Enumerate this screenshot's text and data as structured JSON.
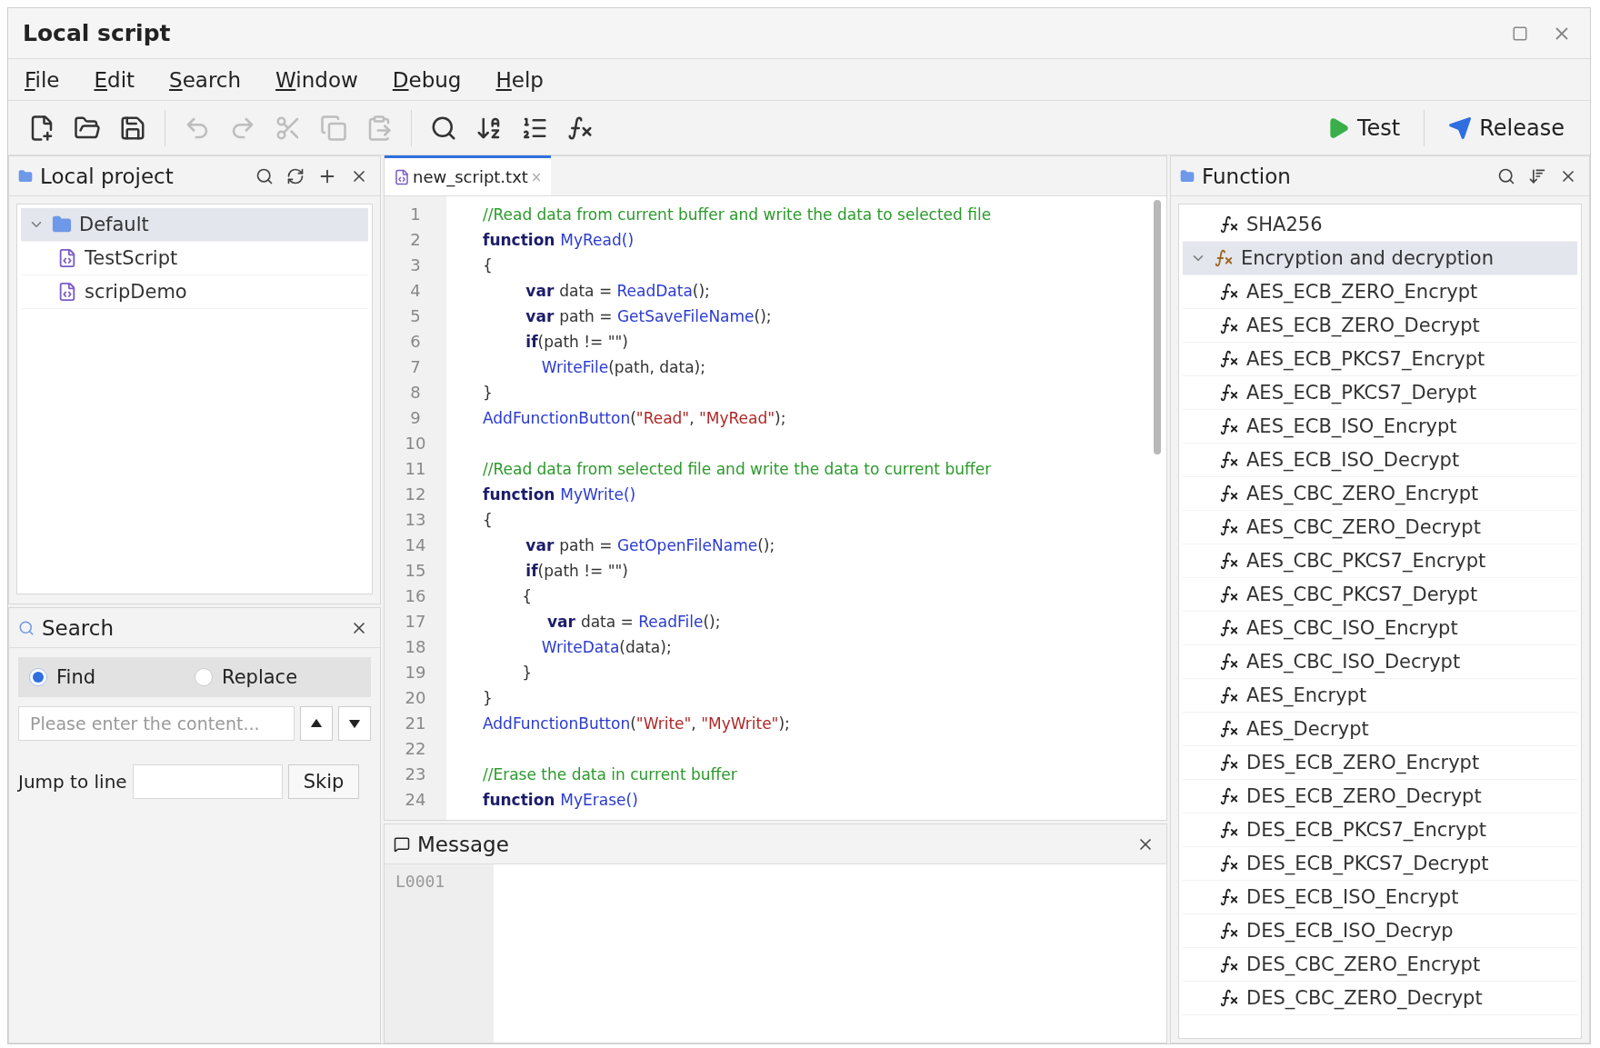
{
  "window": {
    "title": "Local script"
  },
  "menu": [
    {
      "label": "File"
    },
    {
      "label": "Edit"
    },
    {
      "label": "Search"
    },
    {
      "label": "Window"
    },
    {
      "label": "Debug"
    },
    {
      "label": "Help"
    }
  ],
  "toolbar": {
    "buttons": [
      {
        "disabled": false
      },
      {
        "disabled": false
      },
      {
        "disabled": false
      },
      {
        "disabled": true
      },
      {
        "disabled": true
      },
      {
        "disabled": true
      },
      {
        "disabled": true
      },
      {
        "disabled": true
      },
      {
        "disabled": false
      },
      {
        "disabled": false
      },
      {
        "disabled": false
      },
      {
        "disabled": false
      }
    ],
    "actions": [
      {
        "label": "Test"
      },
      {
        "label": "Release"
      }
    ]
  },
  "project_panel": {
    "title": "Local project",
    "tree": [
      {
        "label": "Default",
        "kind": "folder",
        "expanded": true,
        "selected": true,
        "children": [
          {
            "label": "TestScript",
            "kind": "script",
            "selected": false
          },
          {
            "label": "scripDemo",
            "kind": "script",
            "selected": false
          }
        ]
      }
    ]
  },
  "search_panel": {
    "title": "Search",
    "modes": [
      {
        "label": "Find",
        "selected": true
      },
      {
        "label": "Replace",
        "selected": false
      }
    ],
    "search_field": {
      "placeholder": "Please enter the content..."
    },
    "jump_label": "Jump to line",
    "jump_button": "Skip"
  },
  "editor": {
    "tabs": [
      {
        "label": "new_script.txt",
        "selected": true,
        "close": "×"
      }
    ],
    "lines": [
      {
        "number": "1",
        "tokens": [
          {
            "kind": "comment",
            "text": "//Read data from current buffer and write the data to selected file"
          }
        ]
      },
      {
        "number": "2",
        "tokens": [
          {
            "kind": "keyword",
            "text": "function "
          },
          {
            "kind": "func",
            "text": "MyRead()"
          }
        ]
      },
      {
        "number": "3",
        "tokens": [
          {
            "kind": "plain",
            "text": "{"
          }
        ]
      },
      {
        "number": "4",
        "tokens": [
          {
            "kind": "keyword",
            "text": "        var "
          },
          {
            "kind": "plain",
            "text": "data = "
          },
          {
            "kind": "func",
            "text": "ReadData"
          },
          {
            "kind": "plain",
            "text": "();"
          }
        ]
      },
      {
        "number": "5",
        "tokens": [
          {
            "kind": "keyword",
            "text": "        var "
          },
          {
            "kind": "plain",
            "text": "path = "
          },
          {
            "kind": "func",
            "text": "GetSaveFileName"
          },
          {
            "kind": "plain",
            "text": "();"
          }
        ]
      },
      {
        "number": "6",
        "tokens": [
          {
            "kind": "keyword",
            "text": "        if"
          },
          {
            "kind": "plain",
            "text": "(path != \"\")"
          }
        ]
      },
      {
        "number": "7",
        "tokens": [
          {
            "kind": "func",
            "text": "            WriteFile"
          },
          {
            "kind": "plain",
            "text": "(path, data);"
          }
        ]
      },
      {
        "number": "8",
        "tokens": [
          {
            "kind": "plain",
            "text": "}"
          }
        ]
      },
      {
        "number": "9",
        "tokens": [
          {
            "kind": "func",
            "text": "AddFunctionButton"
          },
          {
            "kind": "plain",
            "text": "("
          },
          {
            "kind": "string",
            "text": "\"Read\""
          },
          {
            "kind": "plain",
            "text": ", "
          },
          {
            "kind": "string",
            "text": "\"MyRead\""
          },
          {
            "kind": "plain",
            "text": ");"
          }
        ]
      },
      {
        "number": "10"
      },
      {
        "number": "11",
        "tokens": [
          {
            "kind": "comment",
            "text": "//Read data from selected file and write the data to current buffer"
          }
        ]
      },
      {
        "number": "12",
        "tokens": [
          {
            "kind": "keyword",
            "text": "function "
          },
          {
            "kind": "func",
            "text": "MyWrite()"
          }
        ]
      },
      {
        "number": "13",
        "tokens": [
          {
            "kind": "plain",
            "text": "{"
          }
        ]
      },
      {
        "number": "14",
        "tokens": [
          {
            "kind": "keyword",
            "text": "        var "
          },
          {
            "kind": "plain",
            "text": "path = "
          },
          {
            "kind": "func",
            "text": "GetOpenFileName"
          },
          {
            "kind": "plain",
            "text": "();"
          }
        ]
      },
      {
        "number": "15",
        "tokens": [
          {
            "kind": "keyword",
            "text": "        if"
          },
          {
            "kind": "plain",
            "text": "(path != \"\")"
          }
        ]
      },
      {
        "number": "16",
        "tokens": [
          {
            "kind": "plain",
            "text": "        {"
          }
        ]
      },
      {
        "number": "17",
        "tokens": [
          {
            "kind": "keyword",
            "text": "            var "
          },
          {
            "kind": "plain",
            "text": "data = "
          },
          {
            "kind": "func",
            "text": "ReadFile"
          },
          {
            "kind": "plain",
            "text": "();"
          }
        ]
      },
      {
        "number": "18",
        "tokens": [
          {
            "kind": "func",
            "text": "            WriteData"
          },
          {
            "kind": "plain",
            "text": "(data);"
          }
        ]
      },
      {
        "number": "19",
        "tokens": [
          {
            "kind": "plain",
            "text": "        }"
          }
        ]
      },
      {
        "number": "20",
        "tokens": [
          {
            "kind": "plain",
            "text": "}"
          }
        ]
      },
      {
        "number": "21",
        "tokens": [
          {
            "kind": "func",
            "text": "AddFunctionButton"
          },
          {
            "kind": "plain",
            "text": "("
          },
          {
            "kind": "string",
            "text": "\"Write\""
          },
          {
            "kind": "plain",
            "text": ", "
          },
          {
            "kind": "string",
            "text": "\"MyWrite\""
          },
          {
            "kind": "plain",
            "text": ");"
          }
        ]
      },
      {
        "number": "22"
      },
      {
        "number": "23",
        "tokens": [
          {
            "kind": "comment",
            "text": "//Erase the data in current buffer"
          }
        ]
      },
      {
        "number": "24",
        "tokens": [
          {
            "kind": "keyword",
            "text": "function "
          },
          {
            "kind": "func",
            "text": "MyErase()"
          }
        ]
      }
    ]
  },
  "message_panel": {
    "title": "Message",
    "lines": [
      {
        "number": "L0001"
      }
    ]
  },
  "function_panel": {
    "title": "Function",
    "items": [
      {
        "label": "SHA256",
        "kind": "function",
        "selected": false
      },
      {
        "label": "Encryption and decryption",
        "kind": "group",
        "expanded": true,
        "selected": true,
        "children": [
          {
            "label": "AES_ECB_ZERO_Encrypt",
            "kind": "function",
            "selected": false
          },
          {
            "label": "AES_ECB_ZERO_Decrypt",
            "kind": "function",
            "selected": false
          },
          {
            "label": "AES_ECB_PKCS7_Encrypt",
            "kind": "function",
            "selected": false
          },
          {
            "label": "AES_ECB_PKCS7_Derypt",
            "kind": "function",
            "selected": false
          },
          {
            "label": "AES_ECB_ISO_Encrypt",
            "kind": "function",
            "selected": false
          },
          {
            "label": "AES_ECB_ISO_Decrypt",
            "kind": "function",
            "selected": false
          },
          {
            "label": "AES_CBC_ZERO_Encrypt",
            "kind": "function",
            "selected": false
          },
          {
            "label": "AES_CBC_ZERO_Decrypt",
            "kind": "function",
            "selected": false
          },
          {
            "label": "AES_CBC_PKCS7_Encrypt",
            "kind": "function",
            "selected": false
          },
          {
            "label": "AES_CBC_PKCS7_Derypt",
            "kind": "function",
            "selected": false
          },
          {
            "label": "AES_CBC_ISO_Encrypt",
            "kind": "function",
            "selected": false
          },
          {
            "label": "AES_CBC_ISO_Decrypt",
            "kind": "function",
            "selected": false
          },
          {
            "label": "AES_Encrypt",
            "kind": "function",
            "selected": false
          },
          {
            "label": "AES_Decrypt",
            "kind": "function",
            "selected": false
          },
          {
            "label": "DES_ECB_ZERO_Encrypt",
            "kind": "function",
            "selected": false
          },
          {
            "label": "DES_ECB_ZERO_Decrypt",
            "kind": "function",
            "selected": false
          },
          {
            "label": "DES_ECB_PKCS7_Encrypt",
            "kind": "function",
            "selected": false
          },
          {
            "label": "DES_ECB_PKCS7_Decrypt",
            "kind": "function",
            "selected": false
          },
          {
            "label": "DES_ECB_ISO_Encrypt",
            "kind": "function",
            "selected": false
          },
          {
            "label": "DES_ECB_ISO_Decryp",
            "kind": "function",
            "selected": false
          },
          {
            "label": "DES_CBC_ZERO_Encrypt",
            "kind": "function",
            "selected": false
          },
          {
            "label": "DES_CBC_ZERO_Decrypt",
            "kind": "function",
            "selected": false
          }
        ]
      }
    ]
  }
}
